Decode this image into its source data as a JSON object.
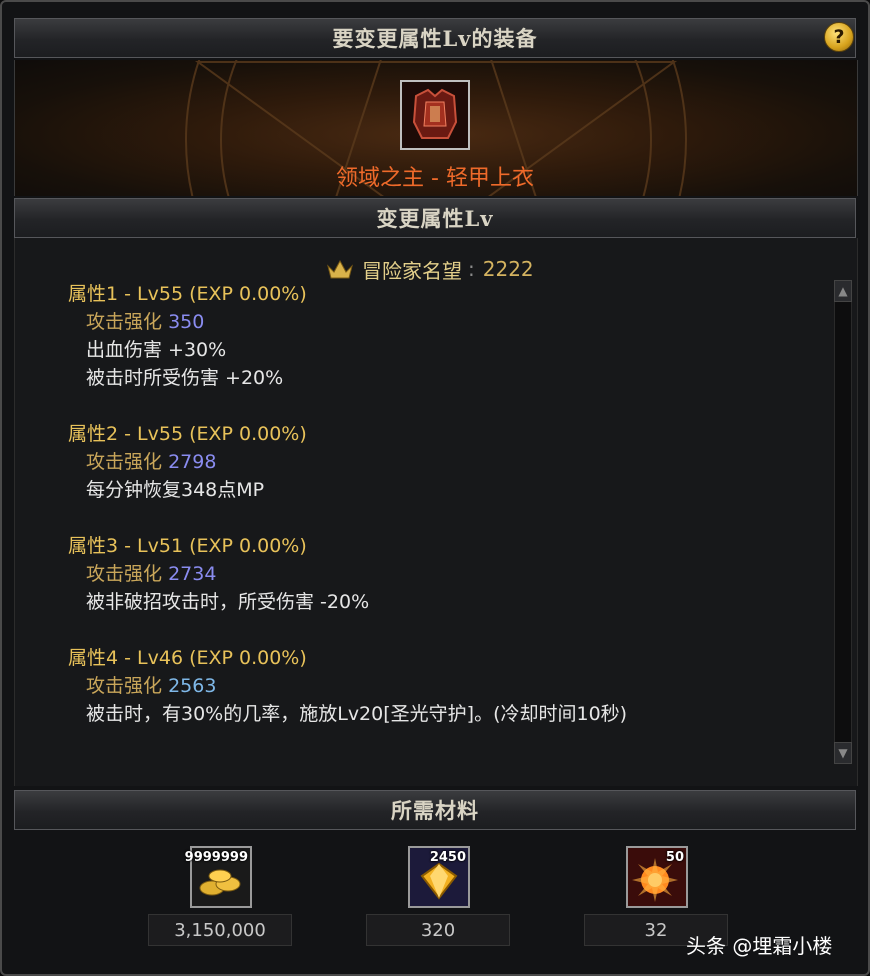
{
  "header": {
    "title": "要变更属性Lv的装备",
    "help_label": "?"
  },
  "item": {
    "name": "领域之主 - 轻甲上衣"
  },
  "section_change": {
    "title": "变更属性Lv"
  },
  "fame": {
    "label": "冒险家名望",
    "value": "2222"
  },
  "attributes": [
    {
      "title": "属性1 - Lv55 (EXP 0.00%)",
      "enhance_label": "攻击强化",
      "enhance_value": "350",
      "effects": [
        "出血伤害 +30%",
        "被击时所受伤害 +20%"
      ]
    },
    {
      "title": "属性2 - Lv55 (EXP 0.00%)",
      "enhance_label": "攻击强化",
      "enhance_value": "2798",
      "effects": [
        "每分钟恢复348点MP"
      ]
    },
    {
      "title": "属性3 - Lv51 (EXP 0.00%)",
      "enhance_label": "攻击强化",
      "enhance_value": "2734",
      "effects": [
        "被非破招攻击时，所受伤害 -20%"
      ]
    },
    {
      "title": "属性4 - Lv46 (EXP 0.00%)",
      "enhance_label": "攻击强化",
      "enhance_value": "2563",
      "effects": [
        "被击时，有30%的几率，施放Lv20[圣光守护]。(冷却时间10秒)"
      ]
    }
  ],
  "materials": {
    "title": "所需材料",
    "items": [
      {
        "icon": "gold-coins-icon",
        "badge": "9999999",
        "qty": "3,150,000"
      },
      {
        "icon": "yellow-gem-icon",
        "badge": "2450",
        "qty": "320"
      },
      {
        "icon": "burst-orb-icon",
        "badge": "50",
        "qty": "32"
      }
    ]
  },
  "watermark": "头条 @埋霜小楼",
  "colors": {
    "item_name": "#ef6a2a",
    "attr_title": "#e8c25a",
    "enhance_value": "#8a8cf0",
    "enhance_value_alt": "#7fb8e8"
  }
}
